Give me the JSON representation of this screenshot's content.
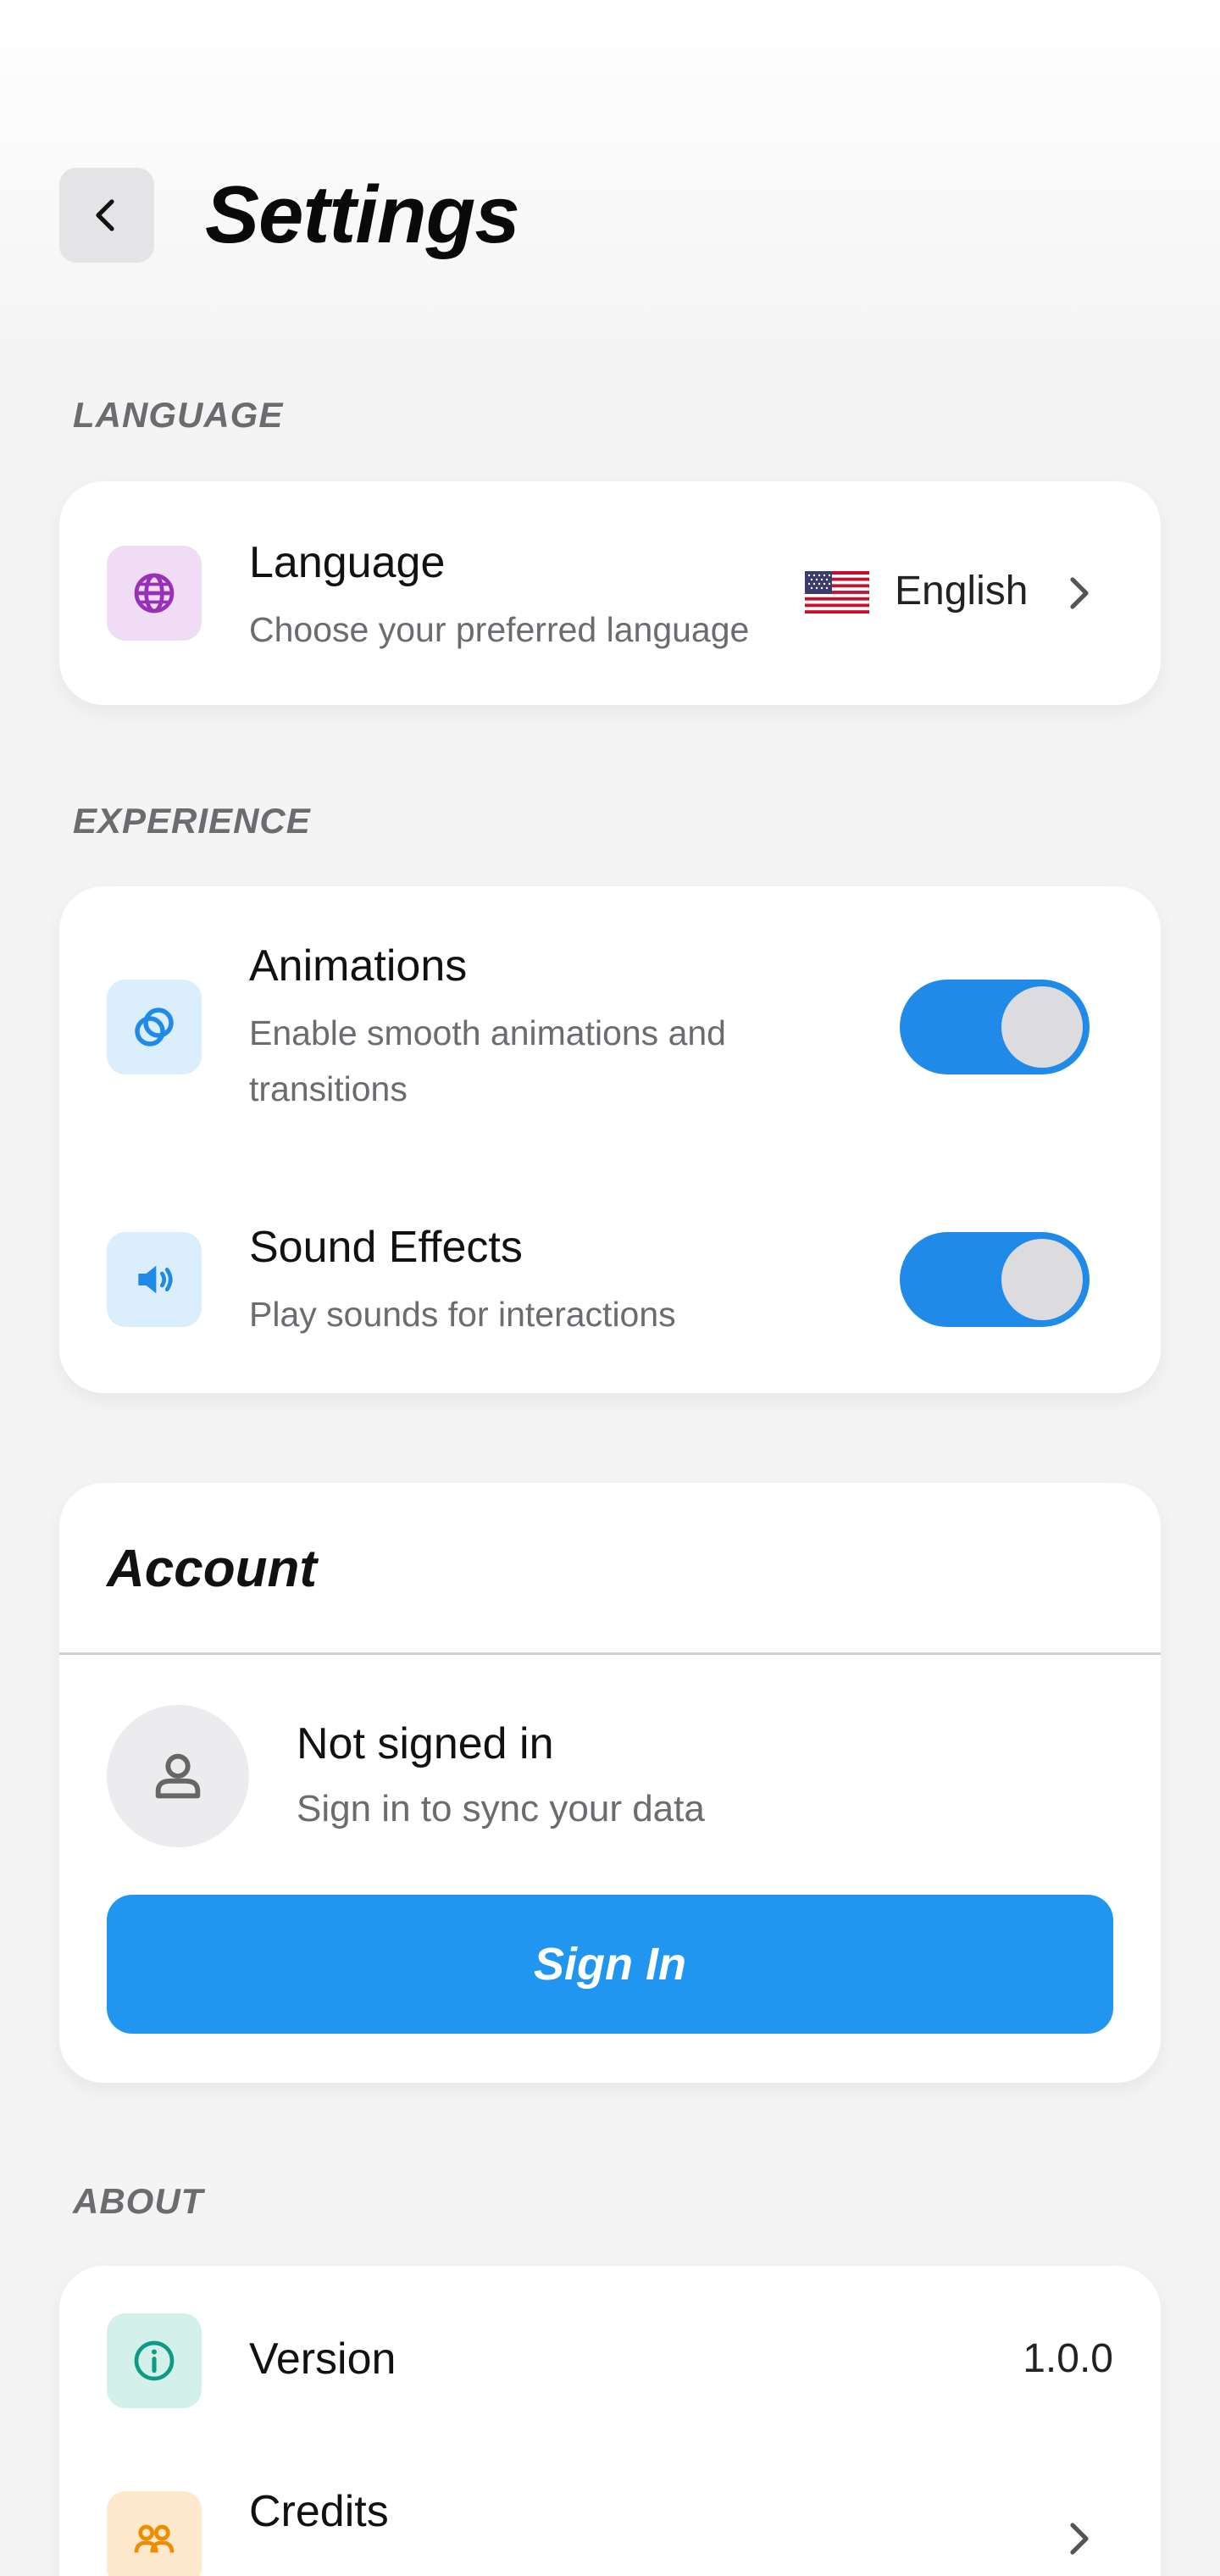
{
  "header": {
    "title": "Settings",
    "back_icon": "chevron-left-icon"
  },
  "sections": {
    "language_label": "LANGUAGE",
    "experience_label": "EXPERIENCE",
    "about_label": "ABOUT"
  },
  "language": {
    "title": "Language",
    "subtitle": "Choose your preferred language",
    "value": "English",
    "flag_icon": "us-flag-icon",
    "icon": "globe-icon",
    "icon_color": "#9b30b8",
    "icon_bg": "#f0dcf4"
  },
  "experience": {
    "animations": {
      "title": "Animations",
      "subtitle_line1": "Enable smooth animations and",
      "subtitle_line2": "transitions",
      "enabled": true,
      "icon": "rings-icon"
    },
    "sound": {
      "title": "Sound Effects",
      "subtitle": "Play sounds for interactions",
      "enabled": true,
      "icon": "speaker-icon"
    },
    "accent": "#1f8ae8"
  },
  "account": {
    "title": "Account",
    "status": "Not signed in",
    "subtitle": "Sign in to sync your data",
    "button_label": "Sign In",
    "button_color": "#2196f0"
  },
  "about": {
    "version_label": "Version",
    "version_value": "1.0.0",
    "credits_label": "Credits"
  }
}
